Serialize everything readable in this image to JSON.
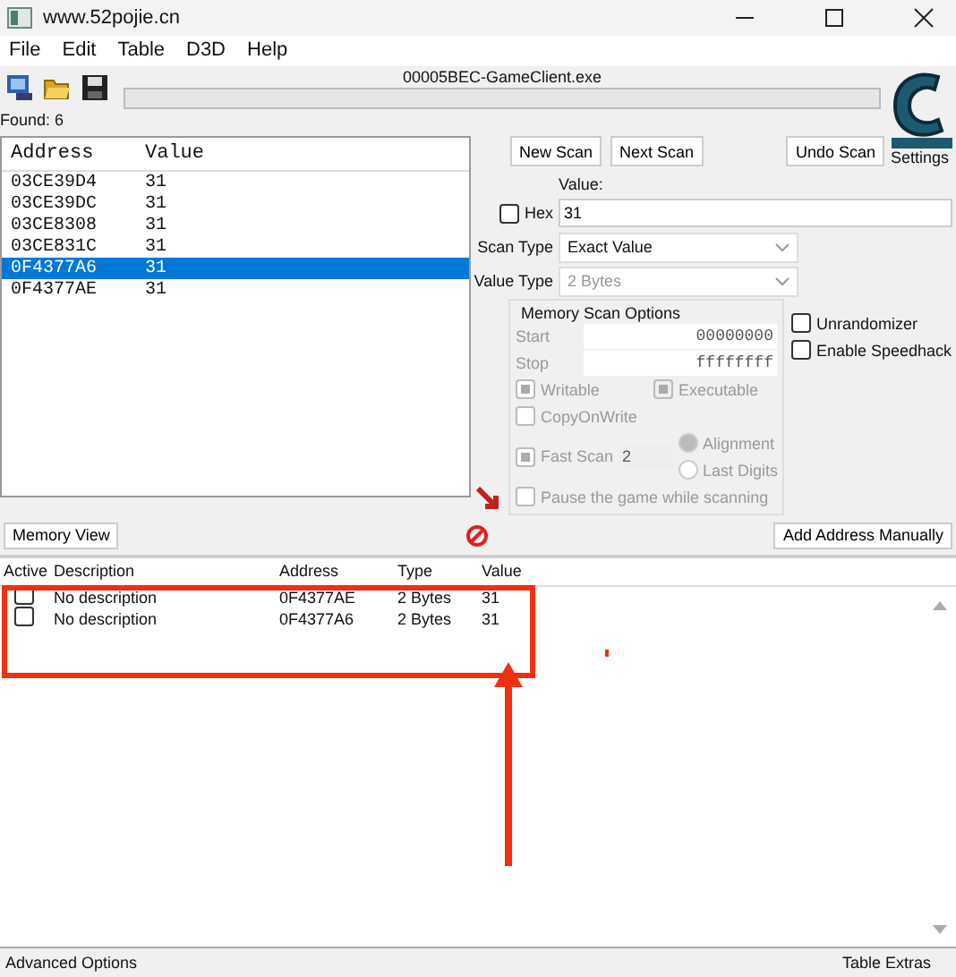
{
  "window": {
    "title": "www.52pojie.cn"
  },
  "menu": [
    "File",
    "Edit",
    "Table",
    "D3D",
    "Help"
  ],
  "process": "00005BEC-GameClient.exe",
  "progress": {
    "level": 0
  },
  "found": "Found: 6",
  "results": {
    "columns": [
      "Address",
      "Value"
    ],
    "rows": [
      {
        "address": "03CE39D4",
        "value": "31",
        "selected": false
      },
      {
        "address": "03CE39DC",
        "value": "31",
        "selected": false
      },
      {
        "address": "03CE8308",
        "value": "31",
        "selected": false
      },
      {
        "address": "03CE831C",
        "value": "31",
        "selected": false
      },
      {
        "address": "0F4377A6",
        "value": "31",
        "selected": true
      },
      {
        "address": "0F4377AE",
        "value": "31",
        "selected": false
      }
    ]
  },
  "scan_buttons": [
    "New Scan",
    "Next Scan"
  ],
  "undo_button": "Undo Scan",
  "settings": "Settings",
  "value_label": "Value:",
  "hex": {
    "label": "Hex",
    "checked": false
  },
  "value": "31",
  "scan_type": {
    "label": "Scan Type",
    "value": "Exact Value",
    "disabled": false
  },
  "value_type": {
    "label": "Value Type",
    "value": "2 Bytes",
    "disabled": true
  },
  "memory_options": {
    "title": "Memory Scan Options",
    "start": {
      "label": "Start",
      "value": "00000000"
    },
    "stop": {
      "label": "Stop",
      "value": "ffffffff"
    },
    "writable": {
      "label": "Writable",
      "checked": true
    },
    "executable": {
      "label": "Executable",
      "checked": true
    },
    "copy_on_write": {
      "label": "CopyOnWrite",
      "checked": false
    },
    "fast_scan": {
      "label": "Fast Scan",
      "checked": true,
      "value": "2"
    },
    "alignment": {
      "label": "Alignment",
      "selected": true
    },
    "last_digits": {
      "label": "Last Digits",
      "selected": false
    },
    "pause": {
      "label": "Pause the game while scanning",
      "checked": false
    }
  },
  "unrandomizer": {
    "label": "Unrandomizer",
    "checked": false
  },
  "speedhack": {
    "label": "Enable Speedhack",
    "checked": false
  },
  "memory_view_button": "Memory View",
  "add_address_button": "Add Address Manually",
  "table": {
    "columns": [
      "Active",
      "Description",
      "Address",
      "Type",
      "Value"
    ],
    "rows": [
      {
        "active": false,
        "description": "No description",
        "address": "0F4377AE",
        "type": "2 Bytes",
        "value": "31"
      },
      {
        "active": false,
        "description": "No description",
        "address": "0F4377A6",
        "type": "2 Bytes",
        "value": "31"
      }
    ]
  },
  "status_bar": {
    "left": "Advanced Options",
    "right": "Table Extras"
  }
}
